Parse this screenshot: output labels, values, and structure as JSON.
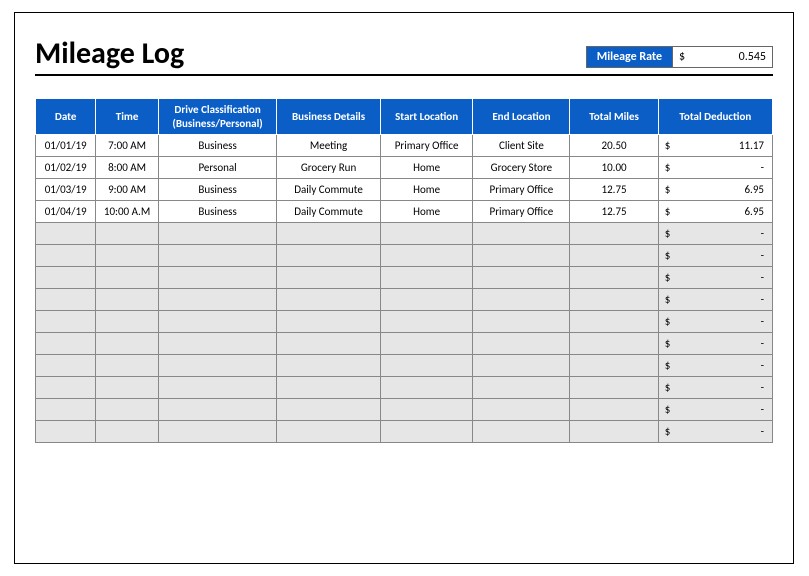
{
  "title": "Mileage Log",
  "rate": {
    "label": "Mileage Rate",
    "currency": "$",
    "value": "0.545"
  },
  "headers": {
    "date": "Date",
    "time": "Time",
    "classification": "Drive Classification (Business/Personal)",
    "details": "Business Details",
    "start": "Start Location",
    "end": "End Location",
    "miles": "Total Miles",
    "deduction": "Total Deduction"
  },
  "rows": [
    {
      "date": "01/01/19",
      "time": "7:00 AM",
      "classification": "Business",
      "details": "Meeting",
      "start": "Primary Office",
      "end": "Client Site",
      "miles": "20.50",
      "deduction_currency": "$",
      "deduction": "11.17"
    },
    {
      "date": "01/02/19",
      "time": "8:00 AM",
      "classification": "Personal",
      "details": "Grocery Run",
      "start": "Home",
      "end": "Grocery Store",
      "miles": "10.00",
      "deduction_currency": "$",
      "deduction": "-"
    },
    {
      "date": "01/03/19",
      "time": "9:00 AM",
      "classification": "Business",
      "details": "Daily Commute",
      "start": "Home",
      "end": "Primary Office",
      "miles": "12.75",
      "deduction_currency": "$",
      "deduction": "6.95"
    },
    {
      "date": "01/04/19",
      "time": "10:00 A.M",
      "classification": "Business",
      "details": "Daily Commute",
      "start": "Home",
      "end": "Primary Office",
      "miles": "12.75",
      "deduction_currency": "$",
      "deduction": "6.95"
    },
    {
      "date": "",
      "time": "",
      "classification": "",
      "details": "",
      "start": "",
      "end": "",
      "miles": "",
      "deduction_currency": "$",
      "deduction": "-"
    },
    {
      "date": "",
      "time": "",
      "classification": "",
      "details": "",
      "start": "",
      "end": "",
      "miles": "",
      "deduction_currency": "$",
      "deduction": "-"
    },
    {
      "date": "",
      "time": "",
      "classification": "",
      "details": "",
      "start": "",
      "end": "",
      "miles": "",
      "deduction_currency": "$",
      "deduction": "-"
    },
    {
      "date": "",
      "time": "",
      "classification": "",
      "details": "",
      "start": "",
      "end": "",
      "miles": "",
      "deduction_currency": "$",
      "deduction": "-"
    },
    {
      "date": "",
      "time": "",
      "classification": "",
      "details": "",
      "start": "",
      "end": "",
      "miles": "",
      "deduction_currency": "$",
      "deduction": "-"
    },
    {
      "date": "",
      "time": "",
      "classification": "",
      "details": "",
      "start": "",
      "end": "",
      "miles": "",
      "deduction_currency": "$",
      "deduction": "-"
    },
    {
      "date": "",
      "time": "",
      "classification": "",
      "details": "",
      "start": "",
      "end": "",
      "miles": "",
      "deduction_currency": "$",
      "deduction": "-"
    },
    {
      "date": "",
      "time": "",
      "classification": "",
      "details": "",
      "start": "",
      "end": "",
      "miles": "",
      "deduction_currency": "$",
      "deduction": "-"
    },
    {
      "date": "",
      "time": "",
      "classification": "",
      "details": "",
      "start": "",
      "end": "",
      "miles": "",
      "deduction_currency": "$",
      "deduction": "-"
    },
    {
      "date": "",
      "time": "",
      "classification": "",
      "details": "",
      "start": "",
      "end": "",
      "miles": "",
      "deduction_currency": "$",
      "deduction": "-"
    }
  ],
  "chart_data": {
    "type": "table",
    "title": "Mileage Log",
    "mileage_rate": 0.545,
    "columns": [
      "Date",
      "Time",
      "Drive Classification (Business/Personal)",
      "Business Details",
      "Start Location",
      "End Location",
      "Total Miles",
      "Total Deduction"
    ],
    "rows": [
      [
        "01/01/19",
        "7:00 AM",
        "Business",
        "Meeting",
        "Primary Office",
        "Client Site",
        20.5,
        11.17
      ],
      [
        "01/02/19",
        "8:00 AM",
        "Personal",
        "Grocery Run",
        "Home",
        "Grocery Store",
        10.0,
        null
      ],
      [
        "01/03/19",
        "9:00 AM",
        "Business",
        "Daily Commute",
        "Home",
        "Primary Office",
        12.75,
        6.95
      ],
      [
        "01/04/19",
        "10:00 A.M",
        "Business",
        "Daily Commute",
        "Home",
        "Primary Office",
        12.75,
        6.95
      ]
    ]
  }
}
